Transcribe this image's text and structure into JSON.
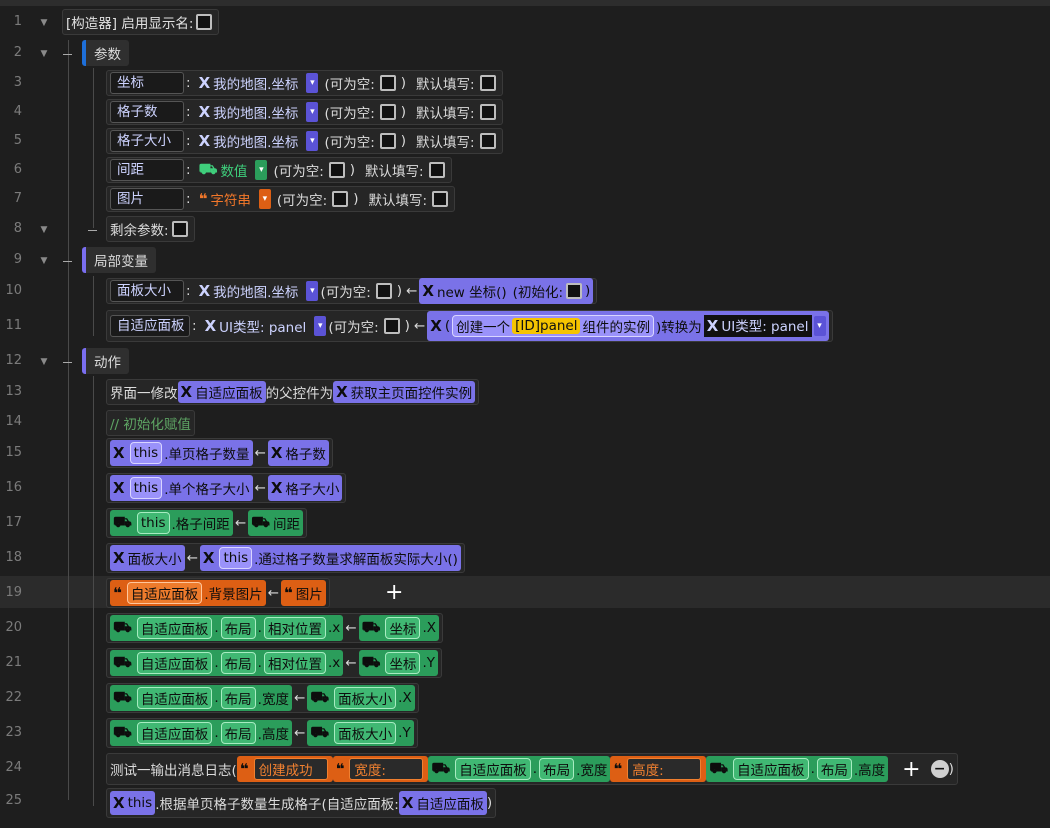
{
  "line_numbers": [
    "1",
    "2",
    "3",
    "4",
    "5",
    "6",
    "7",
    "8",
    "9",
    "10",
    "11",
    "12",
    "13",
    "14",
    "15",
    "16",
    "17",
    "18",
    "19",
    "20",
    "21",
    "22",
    "23",
    "24",
    "25"
  ],
  "row1": {
    "label": "[构造器] 启用显示名:"
  },
  "params": {
    "title": "参数",
    "items": [
      {
        "name": "坐标",
        "type": "我的地图.坐标"
      },
      {
        "name": "格子数",
        "type": "我的地图.坐标"
      },
      {
        "name": "格子大小",
        "type": "我的地图.坐标"
      },
      {
        "name": "间距",
        "type": "数值"
      },
      {
        "name": "图片",
        "type": "字符串"
      }
    ],
    "nullable": "(可为空:",
    "default": "默认填写:",
    "colon": ":",
    "rest": "剩余参数:"
  },
  "locals": {
    "title": "局部变量",
    "v1": {
      "name": "面板大小",
      "type": "我的地图.坐标",
      "init_kw": "new 坐标()",
      "init_label": "(初始化:"
    },
    "v2": {
      "name": "自适应面板",
      "type": "UI类型: panel",
      "create1": "创建一个",
      "create_id": "[ID]panel",
      "create2": "组件的实例",
      "cast": ")转换为",
      "cast_type": "UI类型: panel"
    }
  },
  "actions": {
    "title": "动作",
    "a13": {
      "pre": "界面一修改",
      "ref": "自适应面板",
      "mid": "的父控件为",
      "call": "获取主页面控件实例"
    },
    "a14": {
      "comment": "// 初始化赋值"
    },
    "a15": {
      "this": "this",
      "prop": ".单页格子数量",
      "rhs": "格子数"
    },
    "a16": {
      "this": "this",
      "prop": ".单个格子大小",
      "rhs": "格子大小"
    },
    "a17": {
      "this": "this",
      "prop": ".格子间距",
      "rhs": "间距"
    },
    "a18": {
      "lhs": "面板大小",
      "this": "this",
      "call": ".通过格子数量求解面板实际大小()"
    },
    "a19": {
      "lhs": "自适应面板",
      "prop": ".背景图片",
      "rhs": "图片"
    },
    "a20": {
      "ref": "自适应面板",
      "p1": "布局",
      "p2": "相对位置",
      "p3": ".x",
      "rhs": "坐标",
      "rp": ".X"
    },
    "a21": {
      "ref": "自适应面板",
      "p1": "布局",
      "p2": "相对位置",
      "p3": ".x",
      "rhs": "坐标",
      "rp": ".Y"
    },
    "a22": {
      "ref": "自适应面板",
      "p1": "布局",
      "p2": ".宽度",
      "rhs": "面板大小",
      "rp": ".X"
    },
    "a23": {
      "ref": "自适应面板",
      "p1": "布局",
      "p2": ".高度",
      "rhs": "面板大小",
      "rp": ".Y"
    },
    "a24": {
      "pre": "测试一输出消息日志(",
      "s1": "创建成功",
      "s2": "宽度:",
      "r1": "自适应面板",
      "p1": "布局",
      "p1b": ".宽度",
      "s3": "高度:",
      "r2": "自适应面板",
      "p2": "布局",
      "p2b": ".高度",
      "close": ")"
    },
    "a25": {
      "this": "this",
      "call": ".根据单页格子数量生成格子(自适应面板:",
      "arg": "自适应面板",
      "close": ")"
    }
  },
  "arrow_symbol": "←",
  "dot": ".",
  "colon": ":",
  "close_paren": ")",
  "colors": {
    "purple": "#7a72e8",
    "green": "#2b9d5b",
    "orange": "#dd5f14",
    "bg": "#1e1e1e"
  }
}
